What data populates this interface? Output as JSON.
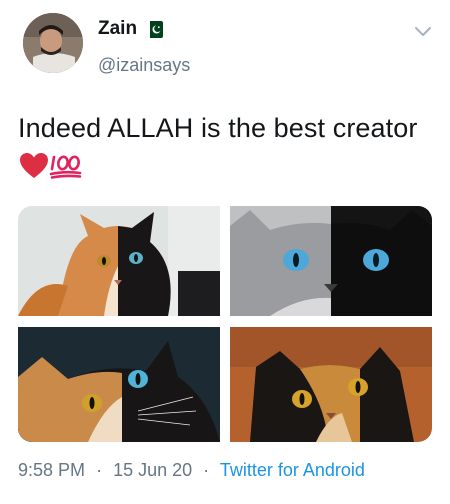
{
  "author": {
    "name": "Zain",
    "handle": "@izainsays",
    "flag": "pakistan-flag"
  },
  "tweet": {
    "text": "Indeed ALLAH is the best creator",
    "emojis": [
      "red-heart",
      "hundred-points"
    ]
  },
  "media": {
    "photos": [
      "cat-photo-1",
      "cat-photo-2",
      "cat-photo-3",
      "cat-photo-4"
    ]
  },
  "meta": {
    "time": "9:58 PM",
    "separator": "·",
    "date": "15 Jun 20",
    "source": "Twitter for Android"
  },
  "colors": {
    "text": "#14171a",
    "muted": "#657786",
    "link": "#1b95e0"
  }
}
